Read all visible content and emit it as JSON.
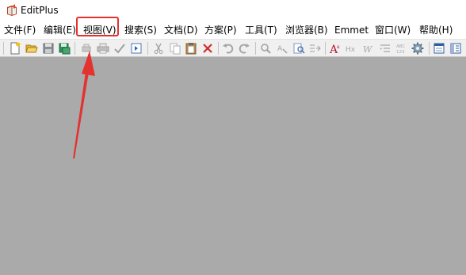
{
  "window": {
    "title": "EditPlus",
    "app_icon": "editplus-book-icon"
  },
  "menu": {
    "items": [
      {
        "label": "文件(F)"
      },
      {
        "label": "编辑(E)"
      },
      {
        "label": "视图(V)"
      },
      {
        "label": "搜索(S)"
      },
      {
        "label": "文档(D)"
      },
      {
        "label": "方案(P)"
      },
      {
        "label": "工具(T)"
      },
      {
        "label": "浏览器(B)"
      },
      {
        "label": "Emmet"
      },
      {
        "label": "窗口(W)"
      },
      {
        "label": "帮助(H)"
      }
    ],
    "highlighted": "视图(V)"
  },
  "toolbar": {
    "icons": [
      "new-file-icon",
      "open-folder-icon",
      "save-icon",
      "save-all-icon",
      "print-preview-icon",
      "print-icon",
      "spell-check-icon",
      "browser-preview-icon",
      "cut-icon",
      "copy-icon",
      "paste-icon",
      "delete-icon",
      "undo-icon",
      "redo-icon",
      "find-icon",
      "replace-icon",
      "find-in-files-icon",
      "goto-line-icon",
      "font-icon",
      "heading-icon",
      "word-wrap-icon",
      "indent-icon",
      "column-select-icon",
      "settings-gear-icon",
      "output-window-icon",
      "directory-window-icon"
    ]
  },
  "annotation": {
    "highlight_color": "#e2332f",
    "arrow_color": "#e2332f"
  },
  "colors": {
    "workspace": "#aaaaaa",
    "toolbar": "#f0f0f0"
  }
}
